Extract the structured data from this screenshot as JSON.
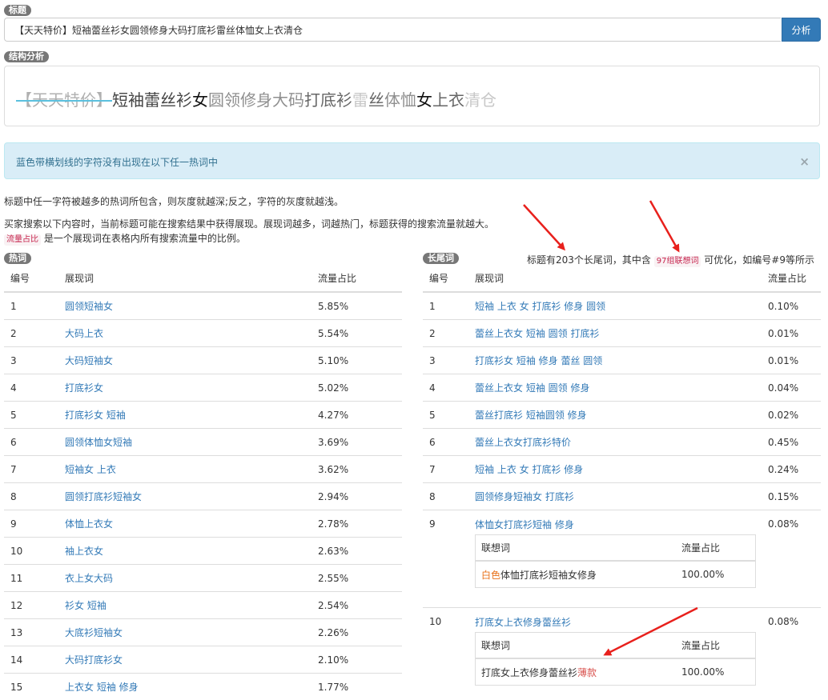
{
  "title_section": {
    "badge": "标题",
    "input_value": "【天天特价】短袖蕾丝衫女圆领修身大码打底衫雷丝体恤女上衣清仓",
    "button_label": "分析"
  },
  "structure_section": {
    "badge": "结构分析",
    "segments": [
      {
        "text": "【天天特价】",
        "shade": "g1",
        "strike": true
      },
      {
        "text": "短袖蕾丝衫",
        "shade": "g4",
        "strike": false
      },
      {
        "text": "女",
        "shade": "g5",
        "strike": false
      },
      {
        "text": "圆领修身大码",
        "shade": "g2",
        "strike": false
      },
      {
        "text": "打底衫",
        "shade": "g3",
        "strike": false
      },
      {
        "text": "雷",
        "shade": "g0",
        "strike": false
      },
      {
        "text": "丝",
        "shade": "g3",
        "strike": false
      },
      {
        "text": "体恤",
        "shade": "g2",
        "strike": false
      },
      {
        "text": "女",
        "shade": "g5",
        "strike": false
      },
      {
        "text": "上衣",
        "shade": "g3",
        "strike": false
      },
      {
        "text": "清仓",
        "shade": "g0",
        "strike": false
      }
    ]
  },
  "alert": {
    "text": "蓝色带横划线的字符没有出现在以下任一热词中",
    "close": "×"
  },
  "descriptions": {
    "line1": "标题中任一字符被越多的热词所包含，则灰度就越深;反之，字符的灰度就越浅。",
    "line2": "买家搜索以下内容时，当前标题可能在搜索结果中获得展现。展现词越多，词越热门，标题获得的搜索流量就越大。",
    "line3_label": "流量占比",
    "line3_rest": "是一个展现词在表格内所有搜索流量中的比例。"
  },
  "hot_words": {
    "badge": "热词",
    "headers": {
      "num": "编号",
      "word": "展现词",
      "ratio": "流量占比"
    },
    "rows": [
      {
        "num": "1",
        "word": "圆领短袖女",
        "ratio": "5.85%"
      },
      {
        "num": "2",
        "word": "大码上衣",
        "ratio": "5.54%"
      },
      {
        "num": "3",
        "word": "大码短袖女",
        "ratio": "5.10%"
      },
      {
        "num": "4",
        "word": "打底衫女",
        "ratio": "5.02%"
      },
      {
        "num": "5",
        "word": "打底衫女 短袖",
        "ratio": "4.27%"
      },
      {
        "num": "6",
        "word": "圆领体恤女短袖",
        "ratio": "3.69%"
      },
      {
        "num": "7",
        "word": "短袖女 上衣",
        "ratio": "3.62%"
      },
      {
        "num": "8",
        "word": "圆领打底衫短袖女",
        "ratio": "2.94%"
      },
      {
        "num": "9",
        "word": "体恤上衣女",
        "ratio": "2.78%"
      },
      {
        "num": "10",
        "word": "袖上衣女",
        "ratio": "2.63%"
      },
      {
        "num": "11",
        "word": "衣上女大码",
        "ratio": "2.55%"
      },
      {
        "num": "12",
        "word": "衫女 短袖",
        "ratio": "2.54%"
      },
      {
        "num": "13",
        "word": "大底衫短袖女",
        "ratio": "2.26%"
      },
      {
        "num": "14",
        "word": "大码打底衫女",
        "ratio": "2.10%"
      },
      {
        "num": "15",
        "word": "上衣女 短袖 修身",
        "ratio": "1.77%"
      }
    ]
  },
  "long_tail": {
    "badge": "长尾词",
    "stats_prefix": "标题有203个长尾词，其中含",
    "stats_label": "97组联想词",
    "stats_suffix": "可优化，如编号#9等所示",
    "headers": {
      "num": "编号",
      "word": "展现词",
      "ratio": "流量占比"
    },
    "rows": [
      {
        "num": "1",
        "word": "短袖 上衣 女 打底衫 修身 圆领",
        "ratio": "0.10%"
      },
      {
        "num": "2",
        "word": "蕾丝上衣女 短袖 圆领 打底衫",
        "ratio": "0.01%"
      },
      {
        "num": "3",
        "word": "打底衫女 短袖 修身 蕾丝 圆领",
        "ratio": "0.01%"
      },
      {
        "num": "4",
        "word": "蕾丝上衣女 短袖 圆领 修身",
        "ratio": "0.04%"
      },
      {
        "num": "5",
        "word": "蕾丝打底衫 短袖圆领 修身",
        "ratio": "0.02%"
      },
      {
        "num": "6",
        "word": "蕾丝上衣女打底衫特价",
        "ratio": "0.45%"
      },
      {
        "num": "7",
        "word": "短袖 上衣 女 打底衫 修身",
        "ratio": "0.24%"
      },
      {
        "num": "8",
        "word": "圆领修身短袖女 打底衫",
        "ratio": "0.15%"
      }
    ],
    "row9": {
      "num": "9",
      "word": "体恤女打底衫短袖 修身",
      "ratio": "0.08%",
      "sub_headers": {
        "word": "联想词",
        "ratio": "流量占比"
      },
      "sub_row": {
        "hl": "白色",
        "rest": "体恤打底衫短袖女修身",
        "ratio": "100.00%"
      }
    },
    "row10": {
      "num": "10",
      "word": "打底女上衣修身蕾丝衫",
      "ratio": "0.08%",
      "sub_headers": {
        "word": "联想词",
        "ratio": "流量占比"
      },
      "sub_row": {
        "rest": "打底女上衣修身蕾丝衫",
        "hl": "薄款",
        "ratio": "100.00%"
      }
    }
  },
  "colors": {
    "accent": "#337ab7",
    "arrow": "#e8201c",
    "alert_bg": "#d9edf7"
  }
}
